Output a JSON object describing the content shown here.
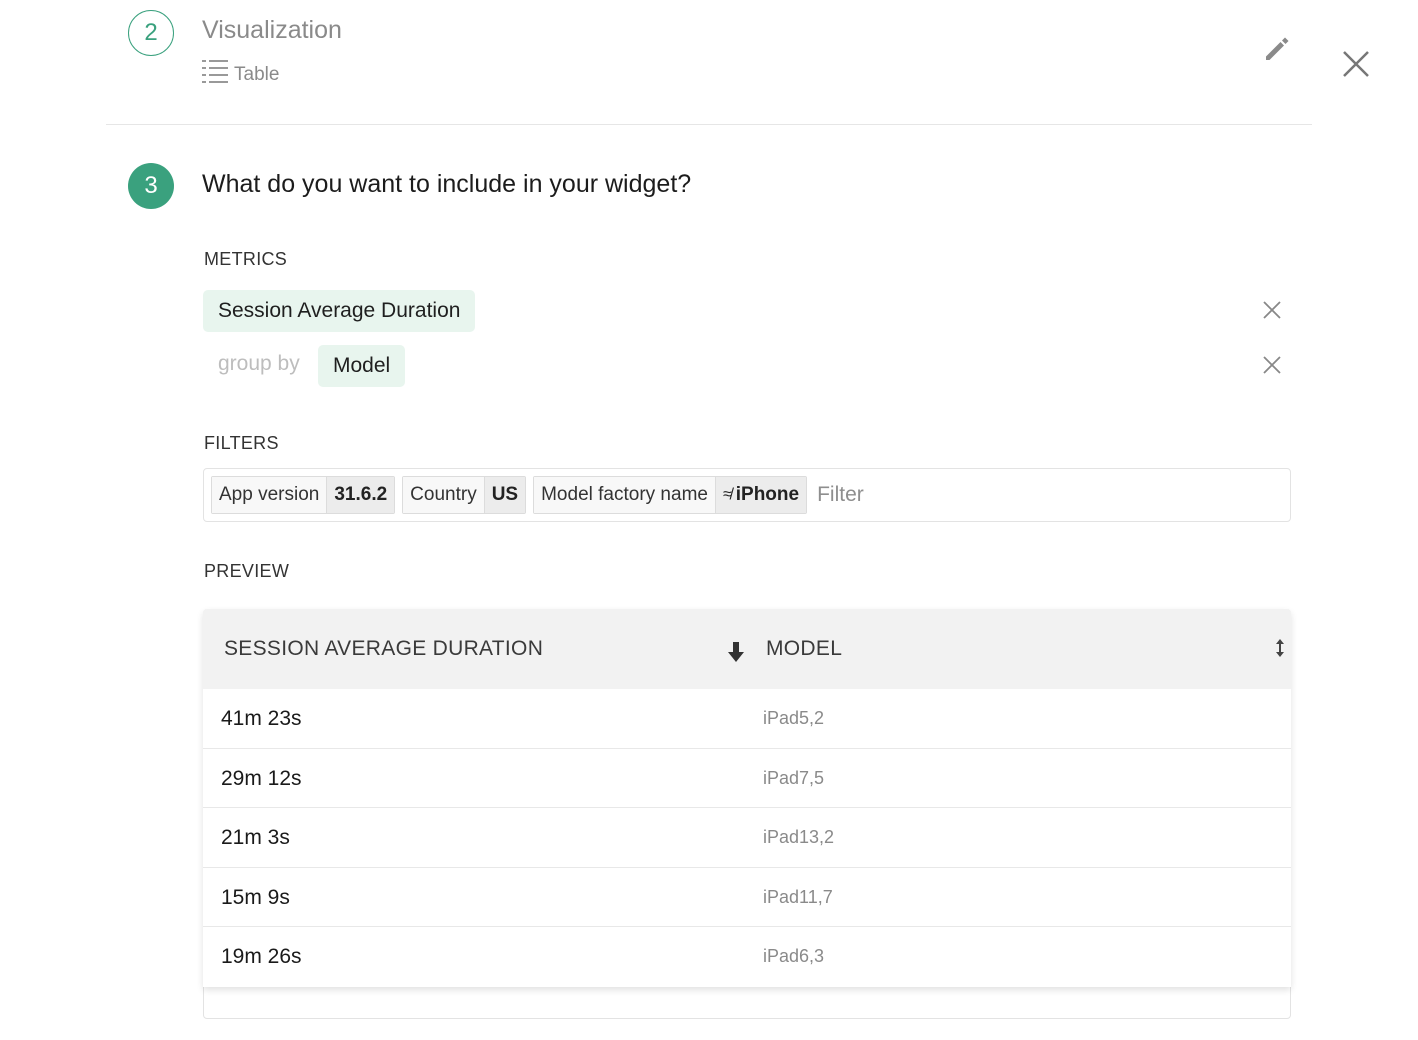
{
  "step2": {
    "number": "2",
    "title": "Visualization",
    "subtitle": "Table",
    "subtitle_icon": "list-icon",
    "edit_icon": "pencil-icon",
    "close_icon": "close-icon"
  },
  "step3": {
    "number": "3",
    "question": "What do you want to include in your widget?"
  },
  "metrics": {
    "label": "METRICS",
    "metric": "Session Average Duration",
    "group_by_label": "group by",
    "group_by_value": "Model"
  },
  "filters": {
    "label": "FILTERS",
    "tags": [
      {
        "key": "App version",
        "operator": "",
        "value": "31.6.2"
      },
      {
        "key": "Country",
        "operator": "",
        "value": "US"
      },
      {
        "key": "Model factory name",
        "operator": "≉",
        "value": "iPhone"
      }
    ],
    "placeholder": "Filter"
  },
  "preview": {
    "label": "PREVIEW",
    "columns": [
      "SESSION AVERAGE DURATION",
      "MODEL"
    ],
    "rows": [
      {
        "duration": "41m 23s",
        "model": "iPad5,2"
      },
      {
        "duration": "29m 12s",
        "model": "iPad7,5"
      },
      {
        "duration": "21m 3s",
        "model": "iPad13,2"
      },
      {
        "duration": "15m 9s",
        "model": "iPad11,7"
      },
      {
        "duration": "19m 26s",
        "model": "iPad6,3"
      }
    ]
  },
  "colors": {
    "accent": "#3aa17e",
    "chip_bg": "#e8f5ee",
    "header_bg": "#f2f2f2"
  }
}
